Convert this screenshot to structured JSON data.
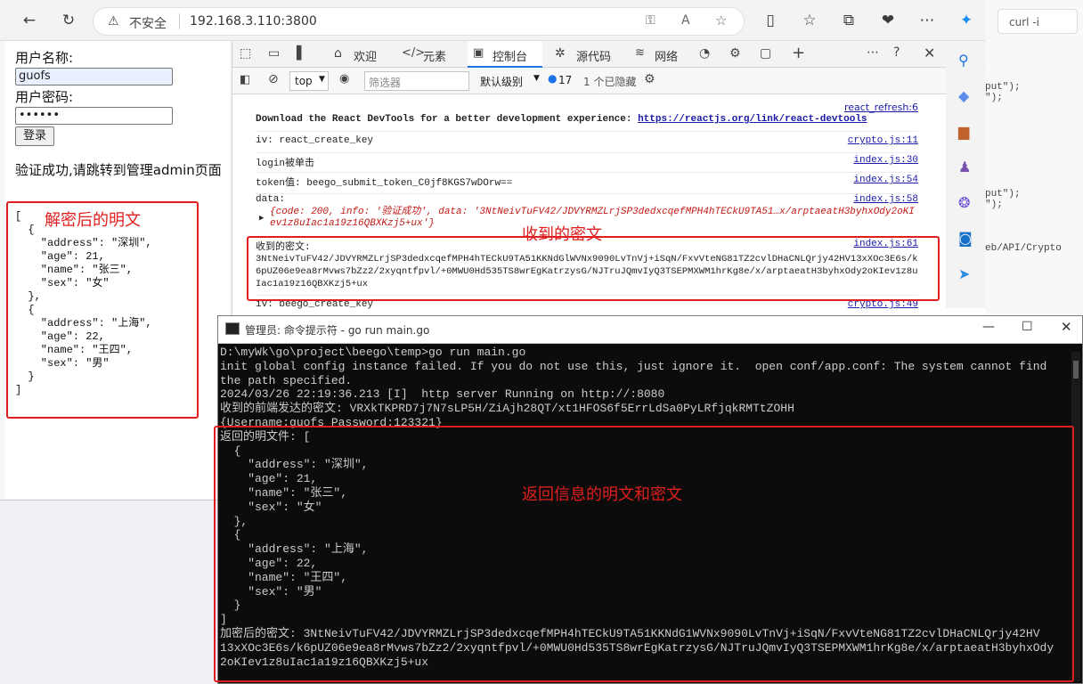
{
  "browser": {
    "insecure_label": "不安全",
    "url": "192.168.3.110:3800"
  },
  "page": {
    "username_label": "用户名称:",
    "username_value": "guofs",
    "password_label": "用户密码:",
    "password_value": "••••••",
    "login_button": "登录",
    "success_message": "验证成功,请跳转到管理admin页面",
    "plaintext_output": "[\n  {\n    \"address\": \"深圳\",\n    \"age\": 21,\n    \"name\": \"张三\",\n    \"sex\": \"女\"\n  },\n  {\n    \"address\": \"上海\",\n    \"age\": 22,\n    \"name\": \"王四\",\n    \"sex\": \"男\"\n  }\n]"
  },
  "devtools": {
    "tabs": [
      "欢迎",
      "元素",
      "控制台",
      "源代码",
      "网络"
    ],
    "context": "top",
    "filter_placeholder": "筛选器",
    "level": "默认级别",
    "issues_count": "17",
    "hidden": "1 个已隐藏",
    "logs": [
      {
        "text": "react_refresh:6",
        "source": "",
        "kind": "srconly"
      },
      {
        "text": "Download the React DevTools for a better development experience: ",
        "link": "https://reactjs.org/link/react-devtools",
        "source": "",
        "kind": "bold"
      },
      {
        "text": "iv: react_create_key",
        "source": "crypto.js:11"
      },
      {
        "text": "login被单击",
        "source": "index.js:30"
      },
      {
        "text": "token值: beego_submit_token_C0jf8KGS7wDOrw==",
        "source": "index.js:54"
      },
      {
        "text": "data:",
        "source": "index.js:58"
      },
      {
        "text": "{code: 200, info: '验证成功', data: '3NtNeivTuFV42/JDVYRMZLrjSP3dedxcqefMPH4hTECkU9TA51…x/arptaeatH3byhxOdy2oKIev1z8uIac1a19z16QBXKzj5+ux'}",
        "source": "",
        "kind": "obj"
      },
      {
        "text": "收到的密文:",
        "source": "index.js:61"
      },
      {
        "text": "3NtNeivTuFV42/JDVYRMZLrjSP3dedxcqefMPH4hTECkU9TA51KKNdGlWVNx9090LvTnVj+iSqN/FxvVteNG81TZ2cvlDHaCNLQrjy42HV13xXOc3E6s/k6pUZ06e9ea8rMvws7bZz2/2xyqntfpvl/+0MWU0Hd535TS8wrEgKatrzysG/NJTruJQmvIyQ3TSEPMXWM1hrKg8e/x/arptaeatH3byhxOdy2oKIev1z8uIac1a19z16QBXKzj5+ux",
        "source": "",
        "kind": "cipher"
      },
      {
        "text": "iv: beego_create_key",
        "source": "crypto.js:49"
      }
    ]
  },
  "annotations": {
    "decrypted_plaintext": "解密后的明文",
    "received_cipher": "收到的密文",
    "returned_info": "返回信息的明文和密文"
  },
  "cmd": {
    "title": "管理员: 命令提示符 - go  run main.go",
    "body": "D:\\myWk\\go\\project\\beego\\temp>go run main.go\ninit global config instance failed. If you do not use this, just ignore it.  open conf/app.conf: The system cannot find\nthe path specified.\n2024/03/26 22:19:36.213 [I]  http server Running on http://:8080\n收到的前端发达的密文: VRXkTKPRD7j7N7sLP5H/ZiAjh28QT/xt1HFOS6f5ErrLdSa0PyLRfjqkRMTtZOHH\n{Username:guofs Password:123321}\n返回的明文件: [\n  {\n    \"address\": \"深圳\",\n    \"age\": 21,\n    \"name\": \"张三\",\n    \"sex\": \"女\"\n  },\n  {\n    \"address\": \"上海\",\n    \"age\": 22,\n    \"name\": \"王四\",\n    \"sex\": \"男\"\n  }\n]\n加密后的密文: 3NtNeivTuFV42/JDVYRMZLrjSP3dedxcqefMPH4hTECkU9TA51KKNdG1WVNx9090LvTnVj+iSqN/FxvVteNG81TZ2cvlDHaCNLQrjy42HV\n13xXOc3E6s/k6pUZ06e9ea8rMvws7bZz2/2xyqntfpvl/+0MWU0Hd535TS8wrEgKatrzysG/NJTruJQmvIyQ3TSEPMXWM1hrKg8e/x/arptaeatH3byhxOdy\n2oKIev1z8uIac1a19z16QBXKzj5+ux"
  },
  "desktop": {
    "tab_label": "curl -i",
    "snippet1": "put\");\n\");",
    "snippet2": "put\");\n\");",
    "snippet3": "eb/API/Crypto"
  }
}
